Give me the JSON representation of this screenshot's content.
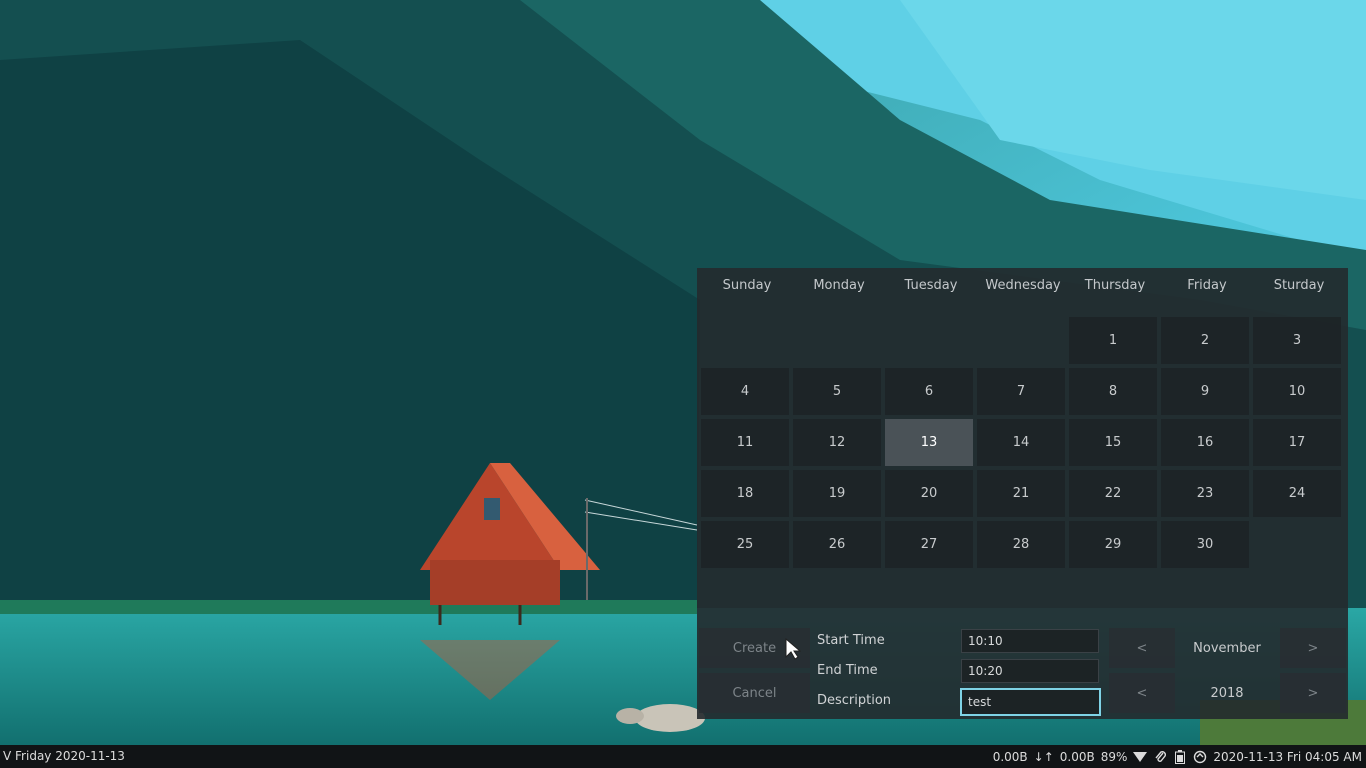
{
  "calendar": {
    "day_headers": [
      "Sunday",
      "Monday",
      "Tuesday",
      "Wednesday",
      "Thursday",
      "Friday",
      "Sturday"
    ],
    "selected_day": "13",
    "days": [
      "",
      "",
      "",
      "",
      "1",
      "2",
      "3",
      "4",
      "5",
      "6",
      "7",
      "8",
      "9",
      "10",
      "11",
      "12",
      "13",
      "14",
      "15",
      "16",
      "17",
      "18",
      "19",
      "20",
      "21",
      "22",
      "23",
      "24",
      "25",
      "26",
      "27",
      "28",
      "29",
      "30",
      ""
    ]
  },
  "form": {
    "create_label": "Create",
    "cancel_label": "Cancel",
    "start_time_label": "Start Time",
    "start_time_value": "10:10",
    "end_time_label": "End Time",
    "end_time_value": "10:20",
    "description_label": "Description",
    "description_value": "test"
  },
  "navigation": {
    "prev_symbol": "<",
    "next_symbol": ">",
    "month": "November",
    "year": "2018"
  },
  "taskbar": {
    "left_text": "V Friday 2020-11-13",
    "net_down": "0.00B",
    "net_arrows": "↓↑",
    "net_up": "0.00B",
    "battery": "89%",
    "datetime": "2020-11-13 Fri 04:05 AM",
    "icons": [
      "wifi-icon",
      "attachment-icon",
      "battery-icon",
      "update-icon"
    ]
  },
  "colors": {
    "accent": "#7fd3e6",
    "today": "#4a5257",
    "panel": "#242a2d"
  }
}
